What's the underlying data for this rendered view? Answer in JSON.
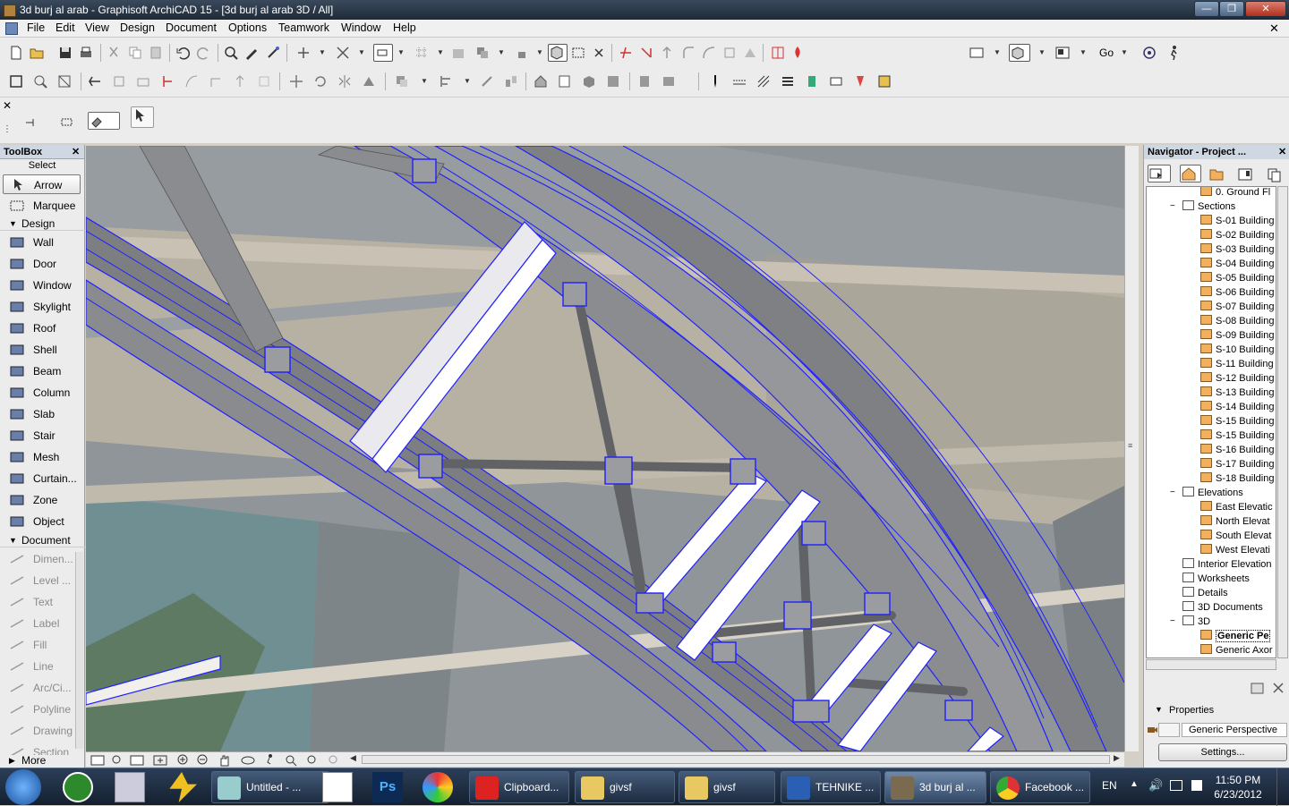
{
  "window": {
    "title": "3d burj al arab - Graphisoft ArchiCAD 15 - [3d burj al arab 3D / All]",
    "min_glyph": "—",
    "max_glyph": "❐",
    "close_glyph": "✕"
  },
  "menu": [
    "File",
    "Edit",
    "View",
    "Design",
    "Document",
    "Options",
    "Teamwork",
    "Window",
    "Help"
  ],
  "toolbar": {
    "go_label": "Go"
  },
  "toolbox": {
    "title": "ToolBox",
    "select_label": "Select",
    "select_items": [
      "Arrow",
      "Marquee"
    ],
    "design_label": "Design",
    "design_items": [
      "Wall",
      "Door",
      "Window",
      "Skylight",
      "Roof",
      "Shell",
      "Beam",
      "Column",
      "Slab",
      "Stair",
      "Mesh",
      "Curtain...",
      "Zone",
      "Object"
    ],
    "document_label": "Document",
    "document_items": [
      "Dimen...",
      "Level ...",
      "Text",
      "Label",
      "Fill",
      "Line",
      "Arc/Ci...",
      "Polyline",
      "Drawing",
      "Section"
    ],
    "more_label": "More"
  },
  "navigator": {
    "title": "Navigator - Project ...",
    "tree": [
      {
        "label": "0. Ground Fl",
        "level": 3,
        "icon": "story"
      },
      {
        "label": "Sections",
        "level": 2,
        "icon": "folder",
        "expanded": true
      },
      {
        "label": "S-01 Building",
        "level": 3,
        "icon": "section"
      },
      {
        "label": "S-02 Building",
        "level": 3,
        "icon": "section"
      },
      {
        "label": "S-03 Building",
        "level": 3,
        "icon": "section"
      },
      {
        "label": "S-04 Building",
        "level": 3,
        "icon": "section"
      },
      {
        "label": "S-05 Building",
        "level": 3,
        "icon": "section"
      },
      {
        "label": "S-06 Building",
        "level": 3,
        "icon": "section"
      },
      {
        "label": "S-07 Building",
        "level": 3,
        "icon": "section"
      },
      {
        "label": "S-08 Building",
        "level": 3,
        "icon": "section"
      },
      {
        "label": "S-09 Building",
        "level": 3,
        "icon": "section"
      },
      {
        "label": "S-10 Building",
        "level": 3,
        "icon": "section"
      },
      {
        "label": "S-11 Building",
        "level": 3,
        "icon": "section"
      },
      {
        "label": "S-12 Building",
        "level": 3,
        "icon": "section"
      },
      {
        "label": "S-13 Building",
        "level": 3,
        "icon": "section"
      },
      {
        "label": "S-14 Building",
        "level": 3,
        "icon": "section"
      },
      {
        "label": "S-15 Building",
        "level": 3,
        "icon": "section"
      },
      {
        "label": "S-15 Building",
        "level": 3,
        "icon": "section"
      },
      {
        "label": "S-16 Building",
        "level": 3,
        "icon": "section"
      },
      {
        "label": "S-17 Building",
        "level": 3,
        "icon": "section"
      },
      {
        "label": "S-18 Building",
        "level": 3,
        "icon": "section"
      },
      {
        "label": "Elevations",
        "level": 2,
        "icon": "folder",
        "expanded": true
      },
      {
        "label": "East Elevatic",
        "level": 3,
        "icon": "elevation"
      },
      {
        "label": "North Elevat",
        "level": 3,
        "icon": "elevation"
      },
      {
        "label": "South Elevat",
        "level": 3,
        "icon": "elevation"
      },
      {
        "label": "West Elevati",
        "level": 3,
        "icon": "elevation"
      },
      {
        "label": "Interior Elevation",
        "level": 2,
        "icon": "folder"
      },
      {
        "label": "Worksheets",
        "level": 2,
        "icon": "folder"
      },
      {
        "label": "Details",
        "level": 2,
        "icon": "folder"
      },
      {
        "label": "3D Documents",
        "level": 2,
        "icon": "folder"
      },
      {
        "label": "3D",
        "level": 2,
        "icon": "folder",
        "expanded": true
      },
      {
        "label": "Generic Pe",
        "level": 3,
        "icon": "camera",
        "selected": true
      },
      {
        "label": "Generic Axor",
        "level": 3,
        "icon": "camera"
      }
    ],
    "properties_label": "Properties",
    "properties_value": "Generic Perspective",
    "settings_label": "Settings..."
  },
  "taskbar": {
    "tasks": [
      "Untitled - ...",
      "Clipboard...",
      "givsf",
      "givsf",
      "TEHNIKE ...",
      "3d burj al ...",
      "Facebook ..."
    ],
    "lang": "EN",
    "time": "11:50 PM",
    "date": "6/23/2012"
  },
  "colors": {
    "titlebar": "#1e2a38",
    "selection_edges": "#2020ff",
    "steel_member": "#8e8e90",
    "wall_beige": "#b9b3a6",
    "sky_grey": "#8f9498"
  }
}
